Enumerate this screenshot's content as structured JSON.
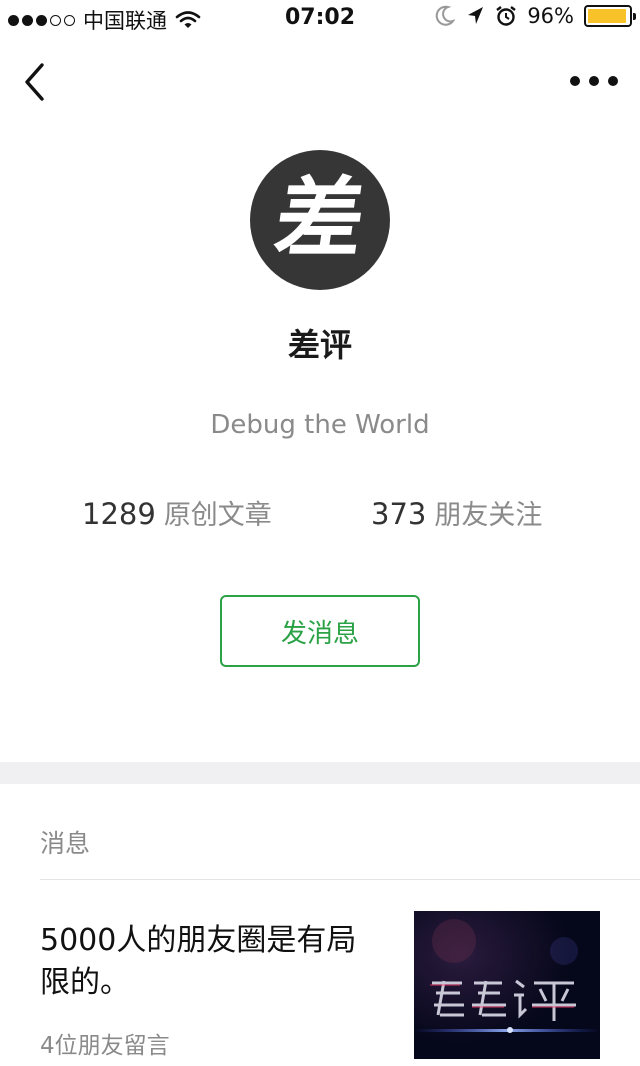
{
  "status_bar": {
    "carrier": "中国联通",
    "time": "07:02",
    "battery": "96%",
    "battery_level": 0.96,
    "signal_bars": 3,
    "signal_total": 5
  },
  "profile": {
    "avatar_char": "差",
    "name": "差评",
    "slogan": "Debug the World",
    "stats": {
      "articles_count": "1289",
      "articles_label": "原创文章",
      "friends_count": "373",
      "friends_label": "朋友关注"
    },
    "message_button": "发消息"
  },
  "messages": {
    "section_title": "消息",
    "items": [
      {
        "title": "5000人的朋友圈是有局限的。",
        "meta": "4位朋友留言",
        "thumbnail": "差评-logo-dark-thumbnail"
      }
    ]
  },
  "colors": {
    "accent_green": "#2ba245",
    "avatar_bg": "#363636",
    "battery_yellow": "#f7c328",
    "secondary_text": "#8a8a8a",
    "divider_gray": "#f0f0f2"
  }
}
